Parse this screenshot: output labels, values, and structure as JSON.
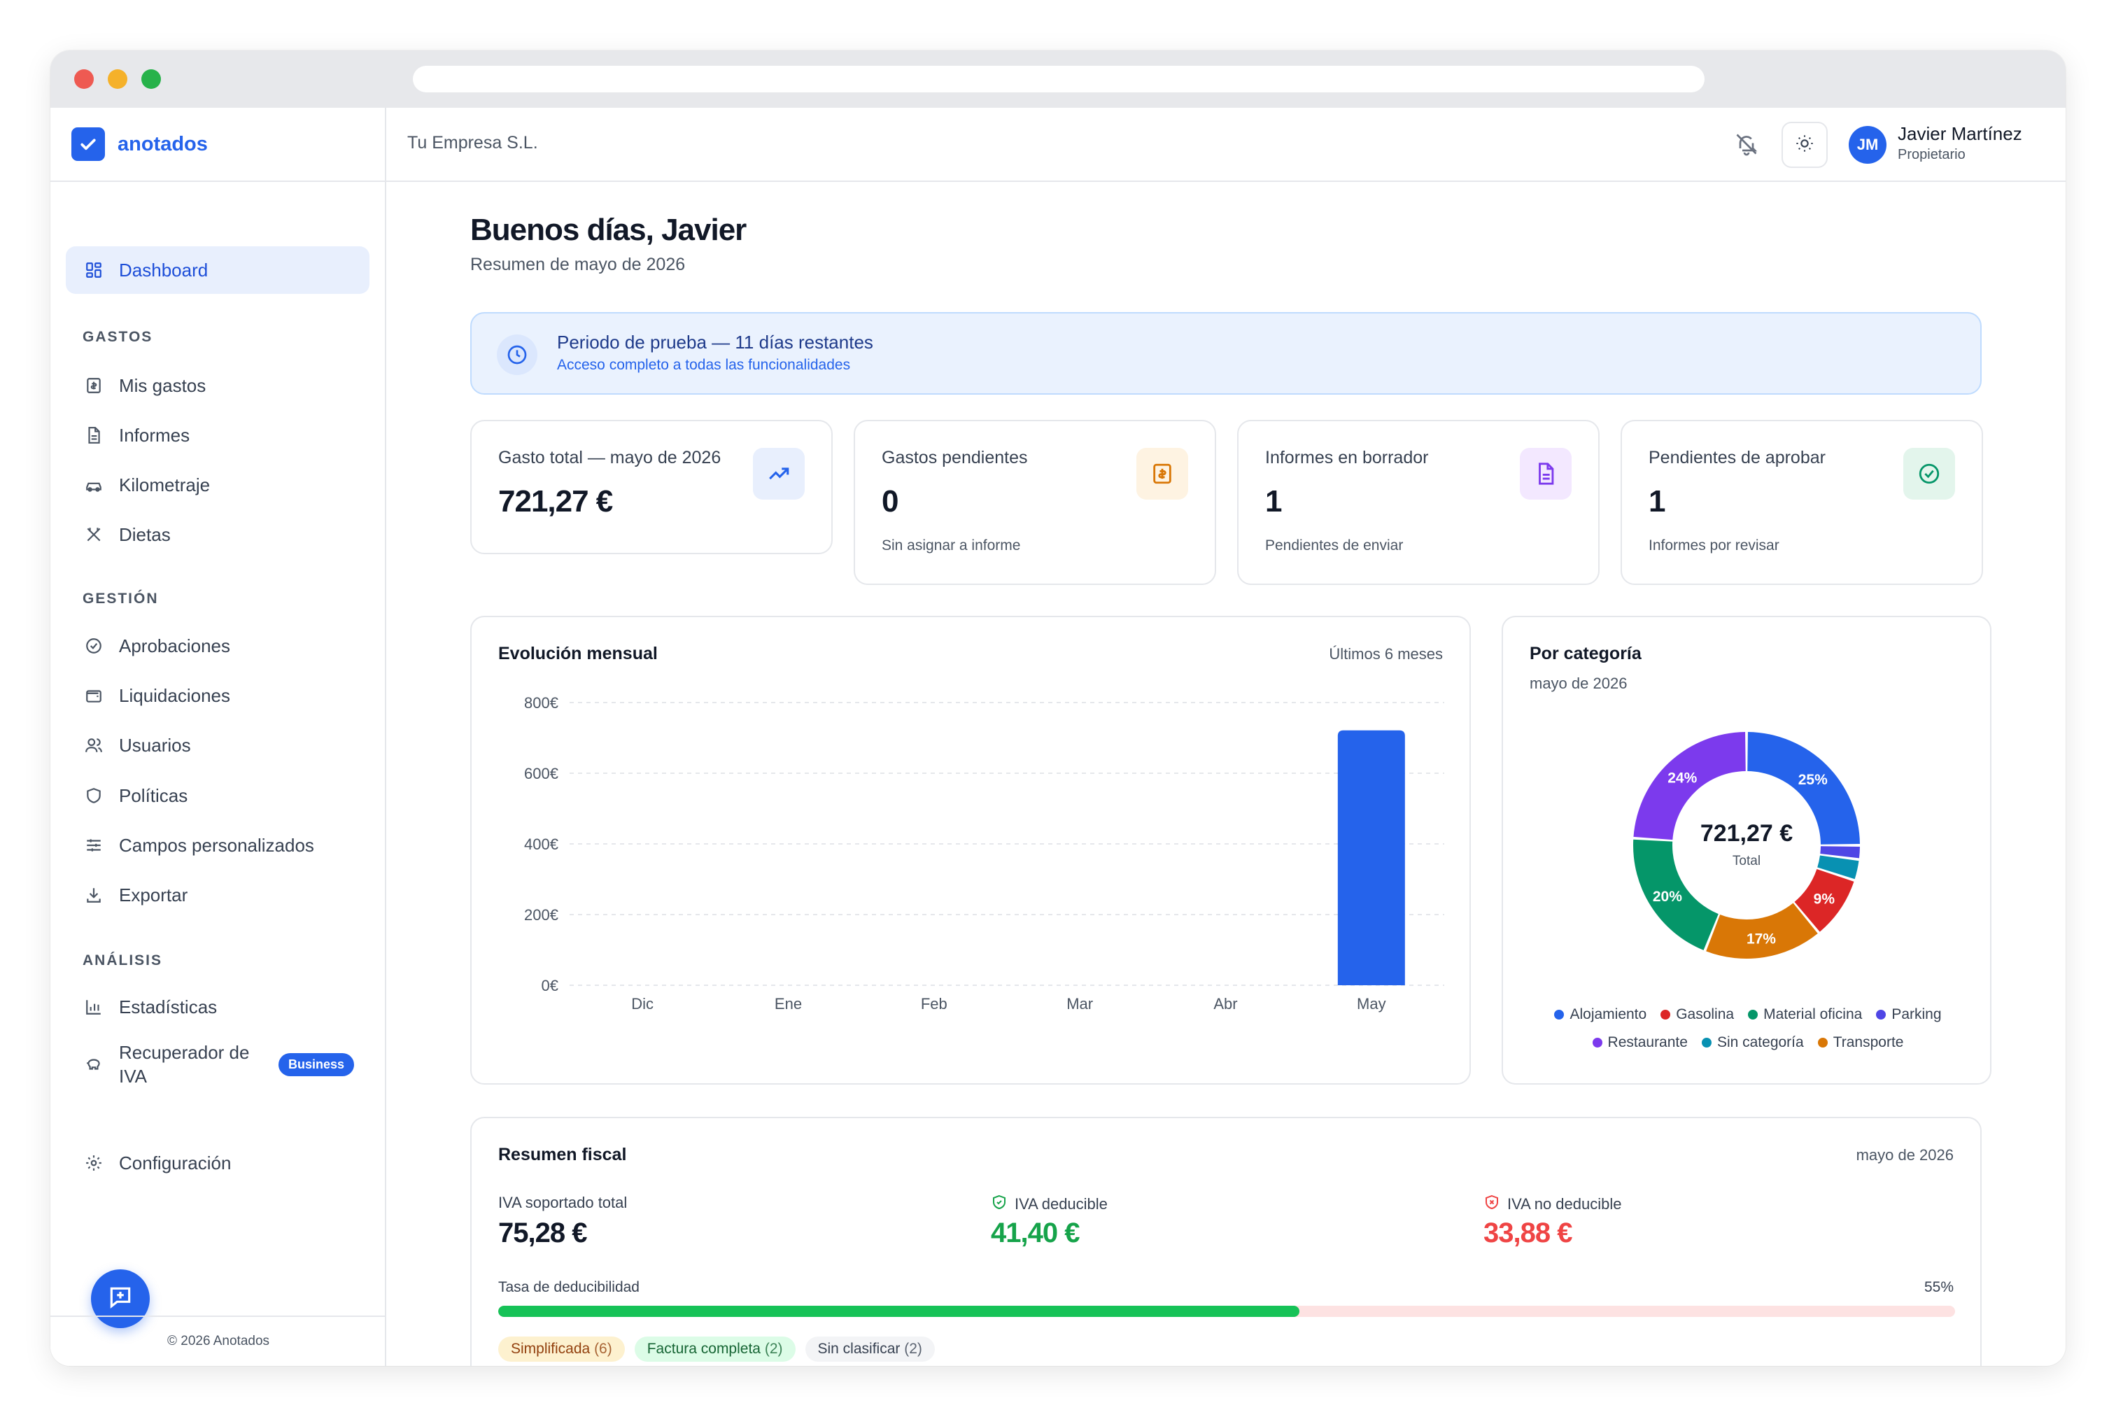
{
  "brand": {
    "name": "anotados"
  },
  "topbar": {
    "company": "Tu Empresa S.L.",
    "user_initials": "JM",
    "user_name": "Javier Martínez",
    "user_role": "Propietario"
  },
  "sidebar": {
    "dashboard": "Dashboard",
    "sections": {
      "gastos": "GASTOS",
      "gestion": "GESTIÓN",
      "analisis": "ANÁLISIS"
    },
    "items": {
      "mis_gastos": "Mis gastos",
      "informes": "Informes",
      "kilometraje": "Kilometraje",
      "dietas": "Dietas",
      "aprobaciones": "Aprobaciones",
      "liquidaciones": "Liquidaciones",
      "usuarios": "Usuarios",
      "politicas": "Políticas",
      "campos": "Campos personalizados",
      "exportar": "Exportar",
      "estadisticas": "Estadísticas",
      "recuperador_l1": "Recuperador de",
      "recuperador_l2": "IVA",
      "configuracion": "Configuración"
    },
    "business_badge": "Business",
    "footer": "© 2026 Anotados"
  },
  "main": {
    "greeting": "Buenos días, Javier",
    "subtitle": "Resumen de mayo de 2026",
    "trial": {
      "title": "Periodo de prueba — 11 días restantes",
      "subtitle": "Acceso completo a todas las funcionalidades"
    }
  },
  "stats": [
    {
      "title": "Gasto total — mayo de 2026",
      "value": "721,27 €",
      "sub": ""
    },
    {
      "title": "Gastos pendientes",
      "value": "0",
      "sub": "Sin asignar a informe"
    },
    {
      "title": "Informes en borrador",
      "value": "1",
      "sub": "Pendientes de enviar"
    },
    {
      "title": "Pendientes de aprobar",
      "value": "1",
      "sub": "Informes por revisar"
    }
  ],
  "monthly": {
    "title": "Evolución mensual",
    "range": "Últimos 6 meses"
  },
  "category": {
    "title": "Por categoría",
    "subtitle": "mayo de 2026",
    "total_value": "721,27 €",
    "total_label": "Total"
  },
  "chart_data": [
    {
      "type": "bar",
      "title": "Evolución mensual",
      "categories": [
        "Dic",
        "Ene",
        "Feb",
        "Mar",
        "Abr",
        "May"
      ],
      "values": [
        0,
        0,
        0,
        0,
        0,
        721.27
      ],
      "ylim": [
        0,
        800
      ],
      "yticks": [
        "0€",
        "200€",
        "400€",
        "600€",
        "800€"
      ],
      "ytick_values": [
        0,
        200,
        400,
        600,
        800
      ],
      "grid": true,
      "color": "#2563eb"
    },
    {
      "type": "pie",
      "title": "Por categoría",
      "slices": [
        {
          "name": "Alojamiento",
          "value": 25,
          "color": "#2563eb",
          "label": "25%"
        },
        {
          "name": "Parking",
          "value": 2,
          "color": "#4f46e5",
          "label": ""
        },
        {
          "name": "Sin categoría",
          "value": 3,
          "color": "#0891b2",
          "label": ""
        },
        {
          "name": "Gasolina",
          "value": 9,
          "color": "#dc2626",
          "label": "9%"
        },
        {
          "name": "Transporte",
          "value": 17,
          "color": "#d97706",
          "label": "17%"
        },
        {
          "name": "Material oficina",
          "value": 20,
          "color": "#059669",
          "label": "20%"
        },
        {
          "name": "Restaurante",
          "value": 24,
          "color": "#7c3aed",
          "label": "24%"
        }
      ],
      "legend": [
        {
          "name": "Alojamiento",
          "color": "#2563eb"
        },
        {
          "name": "Gasolina",
          "color": "#dc2626"
        },
        {
          "name": "Material oficina",
          "color": "#059669"
        },
        {
          "name": "Parking",
          "color": "#4f46e5"
        },
        {
          "name": "Restaurante",
          "color": "#7c3aed"
        },
        {
          "name": "Sin categoría",
          "color": "#0891b2"
        },
        {
          "name": "Transporte",
          "color": "#d97706"
        }
      ]
    }
  ],
  "fiscal": {
    "title": "Resumen fiscal",
    "period": "mayo de 2026",
    "iva_total_label": "IVA soportado total",
    "iva_total_value": "75,28 €",
    "iva_ded_label": "IVA deducible",
    "iva_ded_value": "41,40 €",
    "iva_noded_label": "IVA no deducible",
    "iva_noded_value": "33,88 €",
    "rate_label": "Tasa de deducibilidad",
    "rate_pct": "55%",
    "rate_value": 0.55,
    "chips": [
      {
        "label": "Simplificada",
        "count": "(6)"
      },
      {
        "label": "Factura completa",
        "count": "(2)"
      },
      {
        "label": "Sin clasificar",
        "count": "(2)"
      }
    ]
  },
  "colors": {
    "accent": "#2563eb",
    "success": "#16a34a",
    "danger": "#ef4444"
  }
}
